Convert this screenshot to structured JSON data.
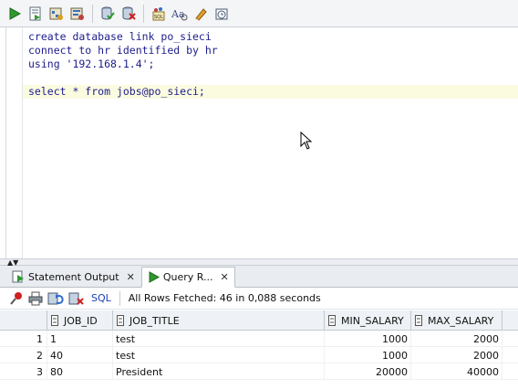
{
  "toolbar": {
    "buttons": [
      {
        "name": "run-statement",
        "icon": "run-icon"
      },
      {
        "name": "run-script",
        "icon": "run-script-icon"
      },
      {
        "name": "autotrace",
        "icon": "autotrace-icon"
      },
      {
        "name": "explain-plan",
        "icon": "explain-plan-icon"
      },
      {
        "name": "commit",
        "icon": "commit-icon"
      },
      {
        "name": "rollback",
        "icon": "rollback-icon"
      },
      {
        "name": "sql-tuning",
        "icon": "sql-tuning-icon"
      },
      {
        "name": "case-toggle",
        "icon": "case-icon"
      },
      {
        "name": "clear",
        "icon": "eraser-icon"
      },
      {
        "name": "history",
        "icon": "history-icon"
      }
    ]
  },
  "editor": {
    "lines": [
      "create database link po_sieci",
      "connect to hr identified by hr",
      "using '192.168.1.4';",
      "",
      "select * from jobs@po_sieci;"
    ]
  },
  "tabs": [
    {
      "label": "Statement Output",
      "close": "✕",
      "active": false
    },
    {
      "label": "Query R...",
      "close": "✕",
      "active": true
    }
  ],
  "results_toolbar": {
    "sql_label": "SQL",
    "status": "All Rows Fetched: 46 in 0,088 seconds"
  },
  "grid": {
    "columns": [
      "JOB_ID",
      "JOB_TITLE",
      "MIN_SALARY",
      "MAX_SALARY"
    ],
    "rows": [
      {
        "num": "1",
        "job_id": "1",
        "job_title": "test",
        "min_salary": "1000",
        "max_salary": "2000"
      },
      {
        "num": "2",
        "job_id": "40",
        "job_title": "test",
        "min_salary": "1000",
        "max_salary": "2000"
      },
      {
        "num": "3",
        "job_id": "80",
        "job_title": "President",
        "min_salary": "20000",
        "max_salary": "40000"
      }
    ]
  },
  "colors": {
    "keyword": "#1c1c8c",
    "current_line": "#fbfbe0",
    "sql_link": "#1a3fb8",
    "run_green": "#2e9a2e"
  }
}
